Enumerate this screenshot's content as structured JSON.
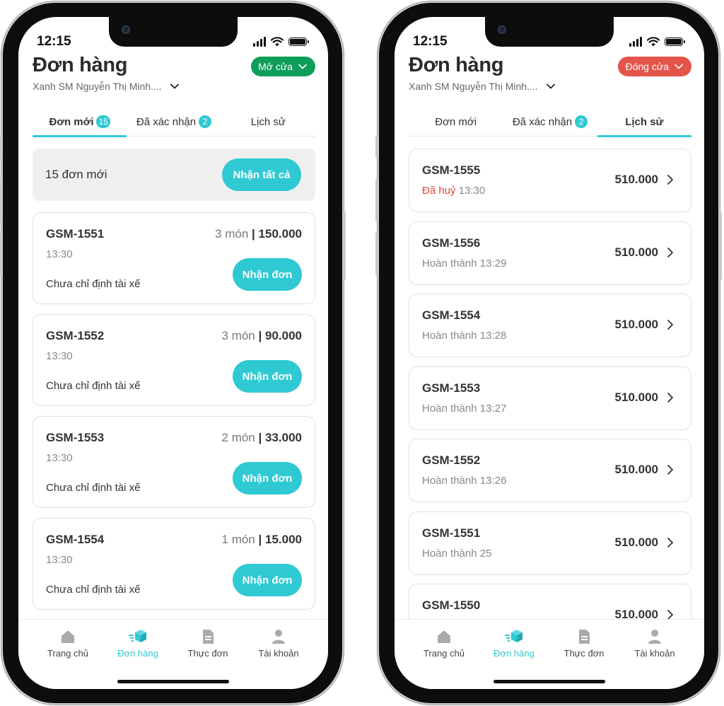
{
  "colors": {
    "accent": "#2fc9d3",
    "open_green": "#0f9e5a",
    "closed_red": "#e5544a",
    "cancel_red": "#e0473a"
  },
  "left": {
    "time": "12:15",
    "title": "Đơn hàng",
    "store": "Xanh SM Nguyễn Thị Minh....",
    "status_btn": "Mở cửa",
    "tabs": [
      {
        "label": "Đơn mới",
        "badge": "15"
      },
      {
        "label": "Đã xác nhận",
        "badge": "2"
      },
      {
        "label": "Lịch sử"
      }
    ],
    "summary": {
      "text": "15 đơn mới",
      "button": "Nhận tất cả"
    },
    "orders": [
      {
        "id": "GSM-1551",
        "qty": "3 món",
        "sep": "|",
        "price": "150.000",
        "time": "13:30",
        "driver": "Chưa chỉ định tài xế",
        "button": "Nhận đơn"
      },
      {
        "id": "GSM-1552",
        "qty": "3 món",
        "sep": "|",
        "price": "90.000",
        "time": "13:30",
        "driver": "Chưa chỉ định tài xế",
        "button": "Nhận đơn"
      },
      {
        "id": "GSM-1553",
        "qty": "2 món",
        "sep": "|",
        "price": "33.000",
        "time": "13:30",
        "driver": "Chưa chỉ định tài xế",
        "button": "Nhận đơn"
      },
      {
        "id": "GSM-1554",
        "qty": "1 món",
        "sep": "|",
        "price": "15.000",
        "time": "13:30",
        "driver": "Chưa chỉ định tài xế",
        "button": "Nhận đơn"
      }
    ]
  },
  "right": {
    "time": "12:15",
    "title": "Đơn hàng",
    "store": "Xanh SM Nguyễn Thị Minh....",
    "status_btn": "Đóng cửa",
    "tabs": [
      {
        "label": "Đơn mới"
      },
      {
        "label": "Đã xác nhận",
        "badge": "2"
      },
      {
        "label": "Lịch sử"
      }
    ],
    "history": [
      {
        "id": "GSM-1555",
        "status": "Đã huỷ",
        "time": "13:30",
        "amount": "510.000"
      },
      {
        "id": "GSM-1556",
        "status": "Hoàn thành",
        "time": "13:29",
        "amount": "510.000"
      },
      {
        "id": "GSM-1554",
        "status": "Hoàn thành",
        "time": "13:28",
        "amount": "510.000"
      },
      {
        "id": "GSM-1553",
        "status": "Hoàn thành",
        "time": "13:27",
        "amount": "510.000"
      },
      {
        "id": "GSM-1552",
        "status": "Hoàn thành",
        "time": "13:26",
        "amount": "510.000"
      },
      {
        "id": "GSM-1551",
        "status": "Hoàn thành",
        "time": "25",
        "amount": "510.000"
      },
      {
        "id": "GSM-1550",
        "status": "",
        "time": "",
        "amount": "510.000"
      }
    ]
  },
  "nav": [
    {
      "label": "Trang chủ",
      "icon": "home-icon"
    },
    {
      "label": "Đơn hàng",
      "icon": "box-icon"
    },
    {
      "label": "Thực đơn",
      "icon": "document-icon"
    },
    {
      "label": "Tài khoản",
      "icon": "user-icon"
    }
  ]
}
